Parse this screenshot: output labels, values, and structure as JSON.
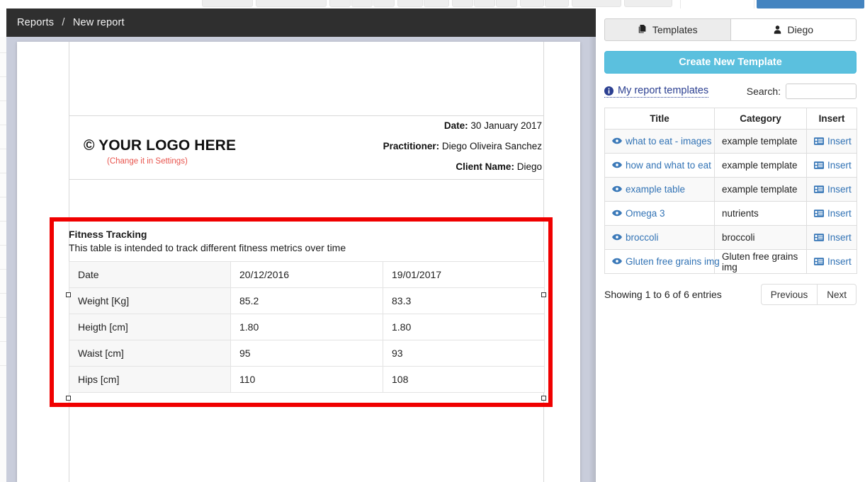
{
  "breadcrumb": {
    "root": "Reports",
    "separator": "/",
    "current": "New report"
  },
  "report": {
    "logo_text": "© YOUR LOGO HERE",
    "logo_subtext": "(Change it in Settings)",
    "date_label": "Date:",
    "date_value": "30 January 2017",
    "practitioner_label": "Practitioner:",
    "practitioner_value": "Diego Oliveira Sanchez",
    "client_label": "Client Name:",
    "client_value": "Diego"
  },
  "fitness_block": {
    "title": "Fitness Tracking",
    "description": "This table is intended to track different fitness metrics over time",
    "table": {
      "rows": [
        {
          "label": "Date",
          "col1": "20/12/2016",
          "col2": "19/01/2017"
        },
        {
          "label": "Weight [Kg]",
          "col1": "85.2",
          "col2": "83.3"
        },
        {
          "label": "Heigth [cm]",
          "col1": "1.80",
          "col2": "1.80"
        },
        {
          "label": "Waist [cm]",
          "col1": "95",
          "col2": "93"
        },
        {
          "label": "Hips [cm]",
          "col1": "110",
          "col2": "108"
        }
      ]
    }
  },
  "sidebar": {
    "tabs": [
      {
        "label": "Templates",
        "icon": "copy-files-icon",
        "active": true
      },
      {
        "label": "Diego",
        "icon": "user-icon",
        "active": false
      }
    ],
    "create_button": "Create New Template",
    "my_templates_link": "My report templates",
    "my_templates_icon": "info-circle-icon",
    "search_label": "Search:",
    "search_value": "",
    "search_placeholder": "",
    "templates_table": {
      "headers": [
        "Title",
        "Category",
        "Insert"
      ],
      "insert_label": "Insert",
      "title_icon": "eye-icon",
      "insert_icon": "list-alt-icon",
      "rows": [
        {
          "title": "what to eat - images",
          "category": "example template"
        },
        {
          "title": "how and what to eat",
          "category": "example template"
        },
        {
          "title": "example table",
          "category": "example template"
        },
        {
          "title": "Omega 3",
          "category": "nutrients"
        },
        {
          "title": "broccoli",
          "category": "broccoli"
        },
        {
          "title": "Gluten free grains img",
          "category": "Gluten free grains img"
        }
      ]
    },
    "entries_info": "Showing 1 to 6 of 6 entries",
    "pagination": {
      "previous": "Previous",
      "next": "Next"
    }
  },
  "colors": {
    "breadcrumb_bar": "#2f2f2f",
    "editor_canvas": "#c9cddb",
    "create_button": "#5bc0de",
    "link": "#3273b5",
    "selection_box": "#f00000",
    "logo_sub": "#e8544d",
    "top_blue_button": "#4484c0"
  }
}
